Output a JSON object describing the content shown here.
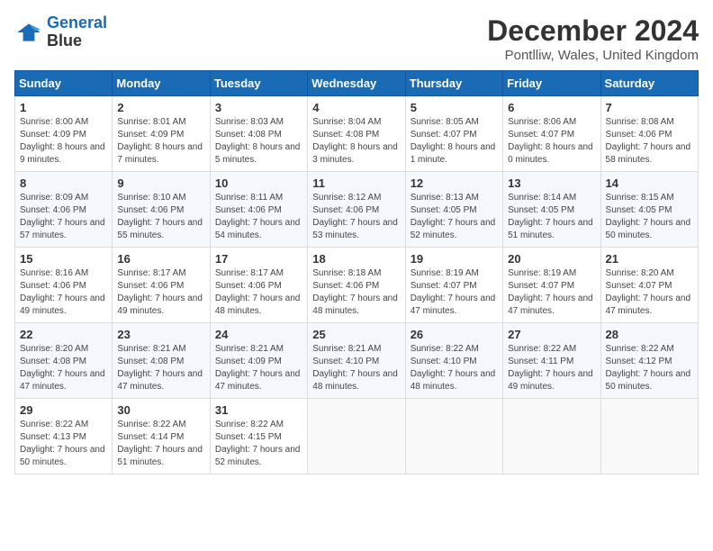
{
  "header": {
    "logo_line1": "General",
    "logo_line2": "Blue",
    "title": "December 2024",
    "subtitle": "Pontlliw, Wales, United Kingdom"
  },
  "days_of_week": [
    "Sunday",
    "Monday",
    "Tuesday",
    "Wednesday",
    "Thursday",
    "Friday",
    "Saturday"
  ],
  "weeks": [
    [
      {
        "day": "1",
        "sunrise": "8:00 AM",
        "sunset": "4:09 PM",
        "daylight": "8 hours and 9 minutes."
      },
      {
        "day": "2",
        "sunrise": "8:01 AM",
        "sunset": "4:09 PM",
        "daylight": "8 hours and 7 minutes."
      },
      {
        "day": "3",
        "sunrise": "8:03 AM",
        "sunset": "4:08 PM",
        "daylight": "8 hours and 5 minutes."
      },
      {
        "day": "4",
        "sunrise": "8:04 AM",
        "sunset": "4:08 PM",
        "daylight": "8 hours and 3 minutes."
      },
      {
        "day": "5",
        "sunrise": "8:05 AM",
        "sunset": "4:07 PM",
        "daylight": "8 hours and 1 minute."
      },
      {
        "day": "6",
        "sunrise": "8:06 AM",
        "sunset": "4:07 PM",
        "daylight": "8 hours and 0 minutes."
      },
      {
        "day": "7",
        "sunrise": "8:08 AM",
        "sunset": "4:06 PM",
        "daylight": "7 hours and 58 minutes."
      }
    ],
    [
      {
        "day": "8",
        "sunrise": "8:09 AM",
        "sunset": "4:06 PM",
        "daylight": "7 hours and 57 minutes."
      },
      {
        "day": "9",
        "sunrise": "8:10 AM",
        "sunset": "4:06 PM",
        "daylight": "7 hours and 55 minutes."
      },
      {
        "day": "10",
        "sunrise": "8:11 AM",
        "sunset": "4:06 PM",
        "daylight": "7 hours and 54 minutes."
      },
      {
        "day": "11",
        "sunrise": "8:12 AM",
        "sunset": "4:06 PM",
        "daylight": "7 hours and 53 minutes."
      },
      {
        "day": "12",
        "sunrise": "8:13 AM",
        "sunset": "4:05 PM",
        "daylight": "7 hours and 52 minutes."
      },
      {
        "day": "13",
        "sunrise": "8:14 AM",
        "sunset": "4:05 PM",
        "daylight": "7 hours and 51 minutes."
      },
      {
        "day": "14",
        "sunrise": "8:15 AM",
        "sunset": "4:05 PM",
        "daylight": "7 hours and 50 minutes."
      }
    ],
    [
      {
        "day": "15",
        "sunrise": "8:16 AM",
        "sunset": "4:06 PM",
        "daylight": "7 hours and 49 minutes."
      },
      {
        "day": "16",
        "sunrise": "8:17 AM",
        "sunset": "4:06 PM",
        "daylight": "7 hours and 49 minutes."
      },
      {
        "day": "17",
        "sunrise": "8:17 AM",
        "sunset": "4:06 PM",
        "daylight": "7 hours and 48 minutes."
      },
      {
        "day": "18",
        "sunrise": "8:18 AM",
        "sunset": "4:06 PM",
        "daylight": "7 hours and 48 minutes."
      },
      {
        "day": "19",
        "sunrise": "8:19 AM",
        "sunset": "4:07 PM",
        "daylight": "7 hours and 47 minutes."
      },
      {
        "day": "20",
        "sunrise": "8:19 AM",
        "sunset": "4:07 PM",
        "daylight": "7 hours and 47 minutes."
      },
      {
        "day": "21",
        "sunrise": "8:20 AM",
        "sunset": "4:07 PM",
        "daylight": "7 hours and 47 minutes."
      }
    ],
    [
      {
        "day": "22",
        "sunrise": "8:20 AM",
        "sunset": "4:08 PM",
        "daylight": "7 hours and 47 minutes."
      },
      {
        "day": "23",
        "sunrise": "8:21 AM",
        "sunset": "4:08 PM",
        "daylight": "7 hours and 47 minutes."
      },
      {
        "day": "24",
        "sunrise": "8:21 AM",
        "sunset": "4:09 PM",
        "daylight": "7 hours and 47 minutes."
      },
      {
        "day": "25",
        "sunrise": "8:21 AM",
        "sunset": "4:10 PM",
        "daylight": "7 hours and 48 minutes."
      },
      {
        "day": "26",
        "sunrise": "8:22 AM",
        "sunset": "4:10 PM",
        "daylight": "7 hours and 48 minutes."
      },
      {
        "day": "27",
        "sunrise": "8:22 AM",
        "sunset": "4:11 PM",
        "daylight": "7 hours and 49 minutes."
      },
      {
        "day": "28",
        "sunrise": "8:22 AM",
        "sunset": "4:12 PM",
        "daylight": "7 hours and 50 minutes."
      }
    ],
    [
      {
        "day": "29",
        "sunrise": "8:22 AM",
        "sunset": "4:13 PM",
        "daylight": "7 hours and 50 minutes."
      },
      {
        "day": "30",
        "sunrise": "8:22 AM",
        "sunset": "4:14 PM",
        "daylight": "7 hours and 51 minutes."
      },
      {
        "day": "31",
        "sunrise": "8:22 AM",
        "sunset": "4:15 PM",
        "daylight": "7 hours and 52 minutes."
      },
      null,
      null,
      null,
      null
    ]
  ]
}
